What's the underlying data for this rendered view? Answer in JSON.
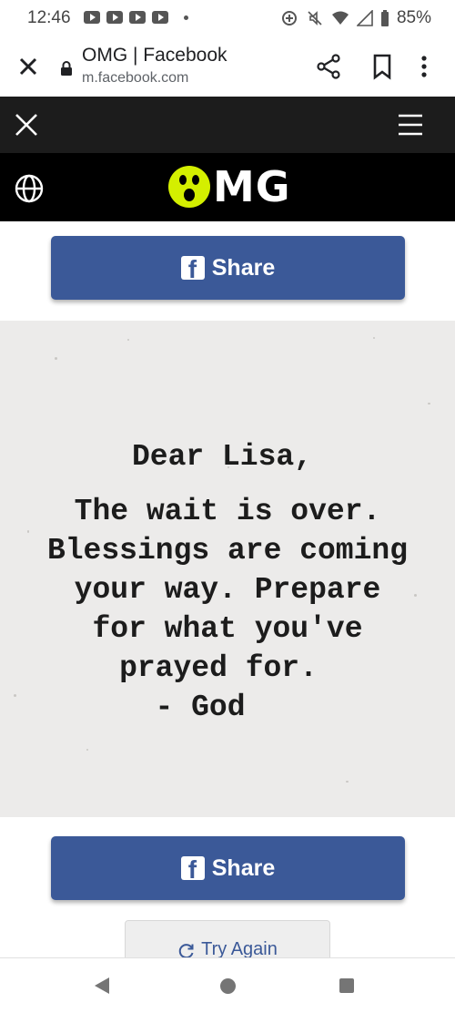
{
  "status_bar": {
    "time": "12:46",
    "battery": "85%"
  },
  "browser": {
    "title": "OMG | Facebook",
    "url": "m.facebook.com"
  },
  "site": {
    "logo_text": "MG"
  },
  "share_buttons": {
    "top_label": "Share",
    "bottom_label": "Share"
  },
  "letter": {
    "greeting": "Dear Lisa,",
    "lines": [
      "The wait is over.",
      "Blessings are coming",
      "your way. Prepare",
      "for what you've",
      "prayed for."
    ],
    "signature": "- God"
  },
  "try_again": {
    "label": "Try Again"
  },
  "colors": {
    "facebook_blue": "#3b5998",
    "logo_yellow": "#d4ef00",
    "letter_bg": "#ecebea"
  }
}
